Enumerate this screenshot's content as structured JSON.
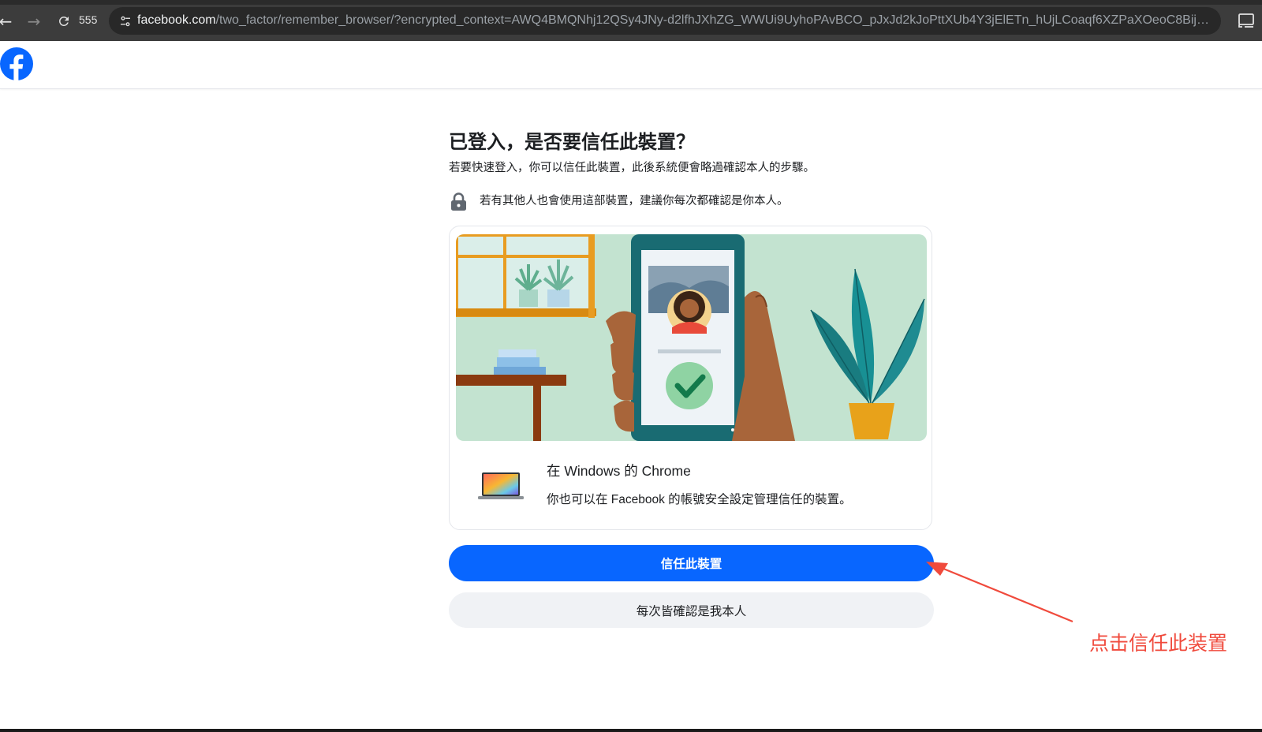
{
  "browser": {
    "tab_count": "555",
    "url_host": "facebook.com",
    "url_path": "/two_factor/remember_browser/?encrypted_context=AWQ4BMQNhj12QSy4JNy-d2lfhJXhZG_WWUi9UyhoPAvBCO_pJxJd2kJoPttXUb4Y3jElETn_hUjLCoaqf6XZPaXOeoC8BijST_lbUsp..."
  },
  "header": {
    "logo": "facebook-logo"
  },
  "main": {
    "title": "已登入，是否要信任此裝置？",
    "subtitle": "若要快速登入，你可以信任此裝置，此後系統便會略過確認本人的步驟。",
    "warning": "若有其他人也會使用這部裝置，建議你每次都確認是你本人。"
  },
  "device": {
    "name": "在 Windows 的 Chrome",
    "description": "你也可以在 Facebook 的帳號安全設定管理信任的裝置。"
  },
  "actions": {
    "trust_label": "信任此裝置",
    "always_confirm_label": "每次皆確認是我本人"
  },
  "annotation": {
    "label": "点击信任此装置",
    "color": "#f04a3c"
  },
  "colors": {
    "brand": "#0866ff",
    "secondary_button": "#f0f2f5"
  }
}
